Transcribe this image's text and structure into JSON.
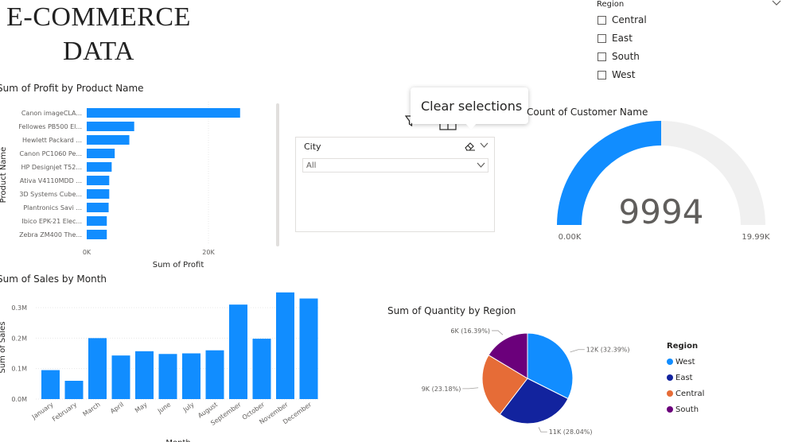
{
  "page": {
    "title_line1": "E-COMMERCE",
    "title_line2": "DATA"
  },
  "region_slicer": {
    "label": "Region",
    "options": [
      "Central",
      "East",
      "South",
      "West"
    ],
    "icon": "chevron-down-icon"
  },
  "tooltip": {
    "text": "Clear selections"
  },
  "city_slicer": {
    "label": "City",
    "selected": "All",
    "icons": [
      "eraser-icon",
      "chevron-down-icon"
    ]
  },
  "visual_header_icons": [
    "filter-icon",
    "focus-mode-icon",
    "more-options-icon"
  ],
  "colors": {
    "bar_blue": "#118DFF",
    "gauge_track": "#F0F0F0",
    "west": "#118DFF",
    "east": "#12239E",
    "central": "#E66C37",
    "south": "#6B007B"
  },
  "chart_data": [
    {
      "type": "bar",
      "orientation": "horizontal",
      "title": "Sum of Profit by Product Name",
      "xlabel": "Sum of Profit",
      "ylabel": "Product Name",
      "categories": [
        "Canon imageCLA...",
        "Fellowes PB500 El...",
        "Hewlett Packard ...",
        "Canon PC1060 Pe...",
        "HP Designjet T52...",
        "Ativa V4110MDD ...",
        "3D Systems Cube...",
        "Plantronics Savi ...",
        "Ibico EPK-21 Elec...",
        "Zebra ZM400 The..."
      ],
      "values": [
        25200,
        7800,
        7000,
        4600,
        4100,
        3700,
        3700,
        3600,
        3300,
        3300
      ],
      "xlim": [
        0,
        30000
      ],
      "xticks": [
        "0K",
        "20K"
      ]
    },
    {
      "type": "bar",
      "title": "Sum of Sales by Month",
      "xlabel": "Month",
      "ylabel": "Sum of Sales",
      "categories": [
        "January",
        "February",
        "March",
        "April",
        "May",
        "June",
        "July",
        "August",
        "September",
        "October",
        "November",
        "December"
      ],
      "values": [
        95000,
        60000,
        200000,
        143000,
        157000,
        148000,
        150000,
        160000,
        310000,
        198000,
        350000,
        330000
      ],
      "ylim": [
        0,
        370000
      ],
      "yticks": [
        "0.0M",
        "0.1M",
        "0.2M",
        "0.3M"
      ]
    },
    {
      "type": "gauge",
      "title": "Count of Customer Name",
      "value": 9994,
      "value_label": "9994",
      "min": 0,
      "max": 19988,
      "min_label": "0.00K",
      "max_label": "19.99K"
    },
    {
      "type": "pie",
      "title": "Sum of Quantity by Region",
      "legend_title": "Region",
      "legend_position": "right",
      "slices": [
        {
          "name": "West",
          "value": 12266,
          "label": "12K (32.39%)"
        },
        {
          "name": "East",
          "value": 10618,
          "label": "11K (28.04%)"
        },
        {
          "name": "Central",
          "value": 8780,
          "label": "9K (23.18%)"
        },
        {
          "name": "South",
          "value": 6209,
          "label": "6K (16.39%)"
        }
      ]
    }
  ]
}
